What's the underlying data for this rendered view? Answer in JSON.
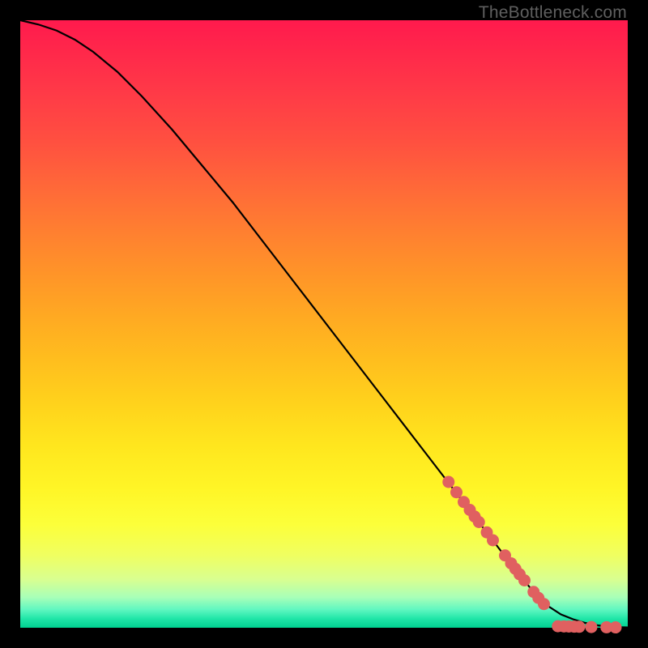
{
  "watermark": "TheBottleneck.com",
  "colors": {
    "frame": "#000000",
    "curve": "#000000",
    "marker_fill": "#e06060",
    "marker_stroke": "#c04848"
  },
  "chart_data": {
    "type": "line",
    "title": "",
    "xlabel": "",
    "ylabel": "",
    "xlim": [
      0,
      100
    ],
    "ylim": [
      0,
      100
    ],
    "series": [
      {
        "name": "curve",
        "x": [
          0,
          3,
          6,
          9,
          12,
          16,
          20,
          25,
          30,
          35,
          40,
          45,
          50,
          55,
          60,
          65,
          70,
          75,
          80,
          84,
          87,
          89,
          91,
          93,
          95,
          97,
          100
        ],
        "y": [
          100,
          99.3,
          98.3,
          96.8,
          94.8,
          91.5,
          87.5,
          82,
          76,
          70,
          63.5,
          57,
          50.5,
          44,
          37.5,
          31,
          24.5,
          18,
          11.5,
          6.5,
          3.5,
          2.2,
          1.4,
          0.8,
          0.4,
          0.15,
          0.05
        ]
      }
    ],
    "markers": [
      {
        "x": 70.5,
        "y": 24.0
      },
      {
        "x": 71.8,
        "y": 22.3
      },
      {
        "x": 73.0,
        "y": 20.7
      },
      {
        "x": 74.0,
        "y": 19.4
      },
      {
        "x": 74.8,
        "y": 18.3
      },
      {
        "x": 75.5,
        "y": 17.4
      },
      {
        "x": 76.8,
        "y": 15.7
      },
      {
        "x": 77.8,
        "y": 14.4
      },
      {
        "x": 79.8,
        "y": 11.9
      },
      {
        "x": 80.8,
        "y": 10.6
      },
      {
        "x": 81.5,
        "y": 9.7
      },
      {
        "x": 82.2,
        "y": 8.8
      },
      {
        "x": 83.0,
        "y": 7.8
      },
      {
        "x": 84.5,
        "y": 5.9
      },
      {
        "x": 85.3,
        "y": 4.9
      },
      {
        "x": 86.2,
        "y": 3.9
      },
      {
        "x": 88.5,
        "y": 0.25
      },
      {
        "x": 89.5,
        "y": 0.22
      },
      {
        "x": 90.3,
        "y": 0.2
      },
      {
        "x": 91.2,
        "y": 0.18
      },
      {
        "x": 92.0,
        "y": 0.16
      },
      {
        "x": 94.0,
        "y": 0.12
      },
      {
        "x": 96.5,
        "y": 0.08
      },
      {
        "x": 98.0,
        "y": 0.06
      }
    ]
  }
}
